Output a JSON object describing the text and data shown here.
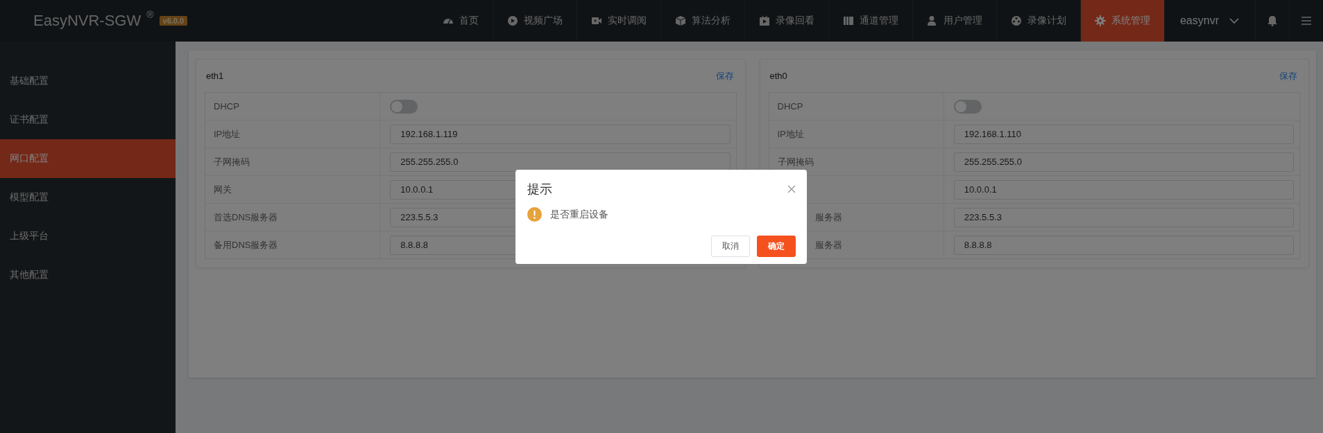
{
  "header": {
    "logo": "EasyNVR-SGW",
    "logo_mark": "®",
    "version": "v6.0.0",
    "nav": [
      {
        "label": "首页",
        "selected": false
      },
      {
        "label": "视频广场",
        "selected": false
      },
      {
        "label": "实时调阅",
        "selected": false
      },
      {
        "label": "算法分析",
        "selected": false
      },
      {
        "label": "录像回看",
        "selected": false
      },
      {
        "label": "通道管理",
        "selected": false
      },
      {
        "label": "用户管理",
        "selected": false
      },
      {
        "label": "录像计划",
        "selected": false
      },
      {
        "label": "系统管理",
        "selected": true
      }
    ],
    "user": "easynvr"
  },
  "sidebar": {
    "items": [
      {
        "label": "基础配置",
        "selected": false
      },
      {
        "label": "证书配置",
        "selected": false
      },
      {
        "label": "网口配置",
        "selected": true
      },
      {
        "label": "模型配置",
        "selected": false
      },
      {
        "label": "上级平台",
        "selected": false
      },
      {
        "label": "其他配置",
        "selected": false
      }
    ]
  },
  "cards": [
    {
      "title": "eth1",
      "save": "保存",
      "rows": [
        {
          "kind": "toggle",
          "label": "DHCP",
          "on": false
        },
        {
          "kind": "input",
          "label": "IP地址",
          "value": "192.168.1.119"
        },
        {
          "kind": "input",
          "label": "子网掩码",
          "value": "255.255.255.0"
        },
        {
          "kind": "input",
          "label": "网关",
          "value": "10.0.0.1"
        },
        {
          "kind": "input",
          "label": "首选DNS服务器",
          "value": "223.5.5.3"
        },
        {
          "kind": "input",
          "label": "备用DNS服务器",
          "value": "8.8.8.8"
        }
      ]
    },
    {
      "title": "eth0",
      "save": "保存",
      "rows": [
        {
          "kind": "toggle",
          "label": "DHCP",
          "on": false
        },
        {
          "kind": "input",
          "label": "IP地址",
          "value": "192.168.1.110"
        },
        {
          "kind": "input",
          "label": "子网掩码",
          "value": "255.255.255.0"
        },
        {
          "kind": "input",
          "value": "10.0.0.1"
        },
        {
          "kind": "input",
          "label": "服务器",
          "label_cut": true,
          "value": "223.5.5.3"
        },
        {
          "kind": "input",
          "label": "服务器",
          "label_cut": true,
          "value": "8.8.8.8"
        }
      ]
    }
  ],
  "dialog": {
    "title": "提示",
    "message": "是否重启设备",
    "buttons": [
      {
        "label": "取消",
        "kind": "secondary"
      },
      {
        "label": "确定",
        "kind": "primary"
      }
    ]
  }
}
